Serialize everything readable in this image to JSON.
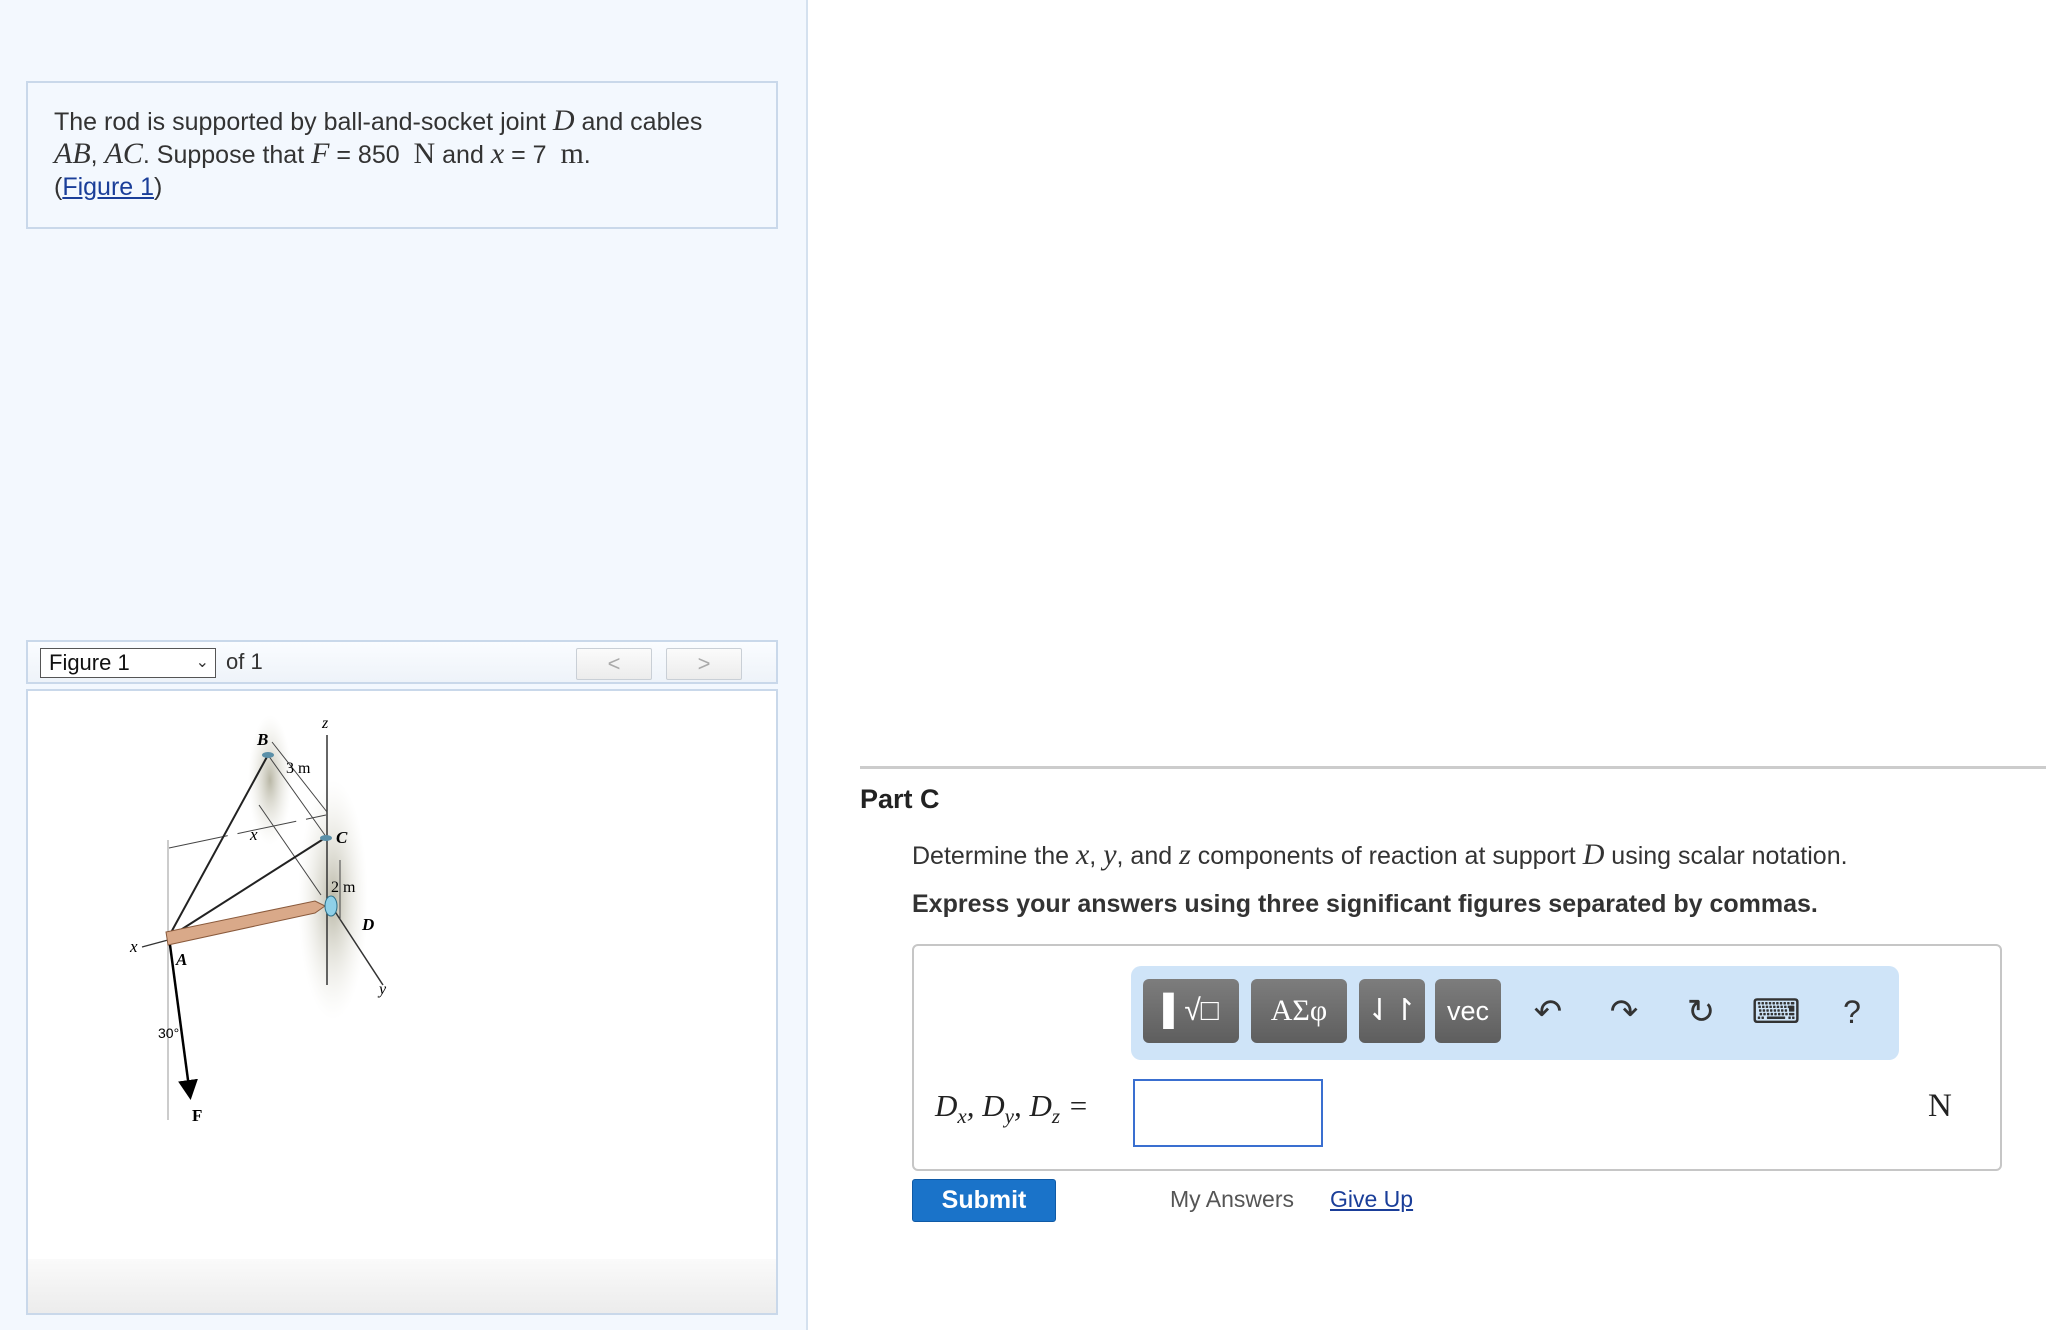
{
  "problem": {
    "t1": "The rod is supported by ball-and-socket joint ",
    "D": "D",
    "t2": " and cables",
    "AB": "AB",
    "comma": ", ",
    "AC": "AC",
    "t3": ". Suppose that ",
    "F": "F",
    "t4": " = 850 ",
    "N": "N",
    "t5": " and ",
    "x": "x",
    "t6": " = 7 ",
    "m": "m",
    "t7": ".",
    "figure_link": "Figure 1"
  },
  "figure_nav": {
    "selected": "Figure 1",
    "of": "of 1",
    "prev": "<",
    "next": ">"
  },
  "figure": {
    "labels": {
      "B": "B",
      "C": "C",
      "D": "D",
      "A": "A",
      "F": "F",
      "z": "z",
      "x_axis": "x",
      "y_axis": "y",
      "x_dim": "x",
      "dim_3m": "3 m",
      "dim_2m": "2 m",
      "angle": "30°"
    },
    "rod_color": "#d9a989"
  },
  "part": {
    "title": "Part C",
    "desc_1": "Determine the ",
    "x": "x",
    "sep1": ", ",
    "y": "y",
    "sep2": ", and ",
    "z": "z",
    "desc_2": " components of reaction at support ",
    "D": "D",
    "desc_3": " using scalar notation.",
    "instruction": "Express your answers using three significant figures separated by commas."
  },
  "toolbar": {
    "templates": "▌√□",
    "greek": "ΑΣφ",
    "arrows": "⇃↾",
    "vec": "vec",
    "undo": "↶",
    "redo": "↷",
    "reset": "↻",
    "keyboard": "⌨",
    "help": "?"
  },
  "answer": {
    "label": "Dx, Dy, Dz =",
    "value": "",
    "unit": "N"
  },
  "actions": {
    "submit": "Submit",
    "my_answers": "My Answers",
    "give_up": "Give Up"
  },
  "colors": {
    "accent": "#1a73c9",
    "link": "#1a3e99",
    "panel_bg": "#f3f8fe",
    "toolbar_bg": "#cfe4f8"
  }
}
